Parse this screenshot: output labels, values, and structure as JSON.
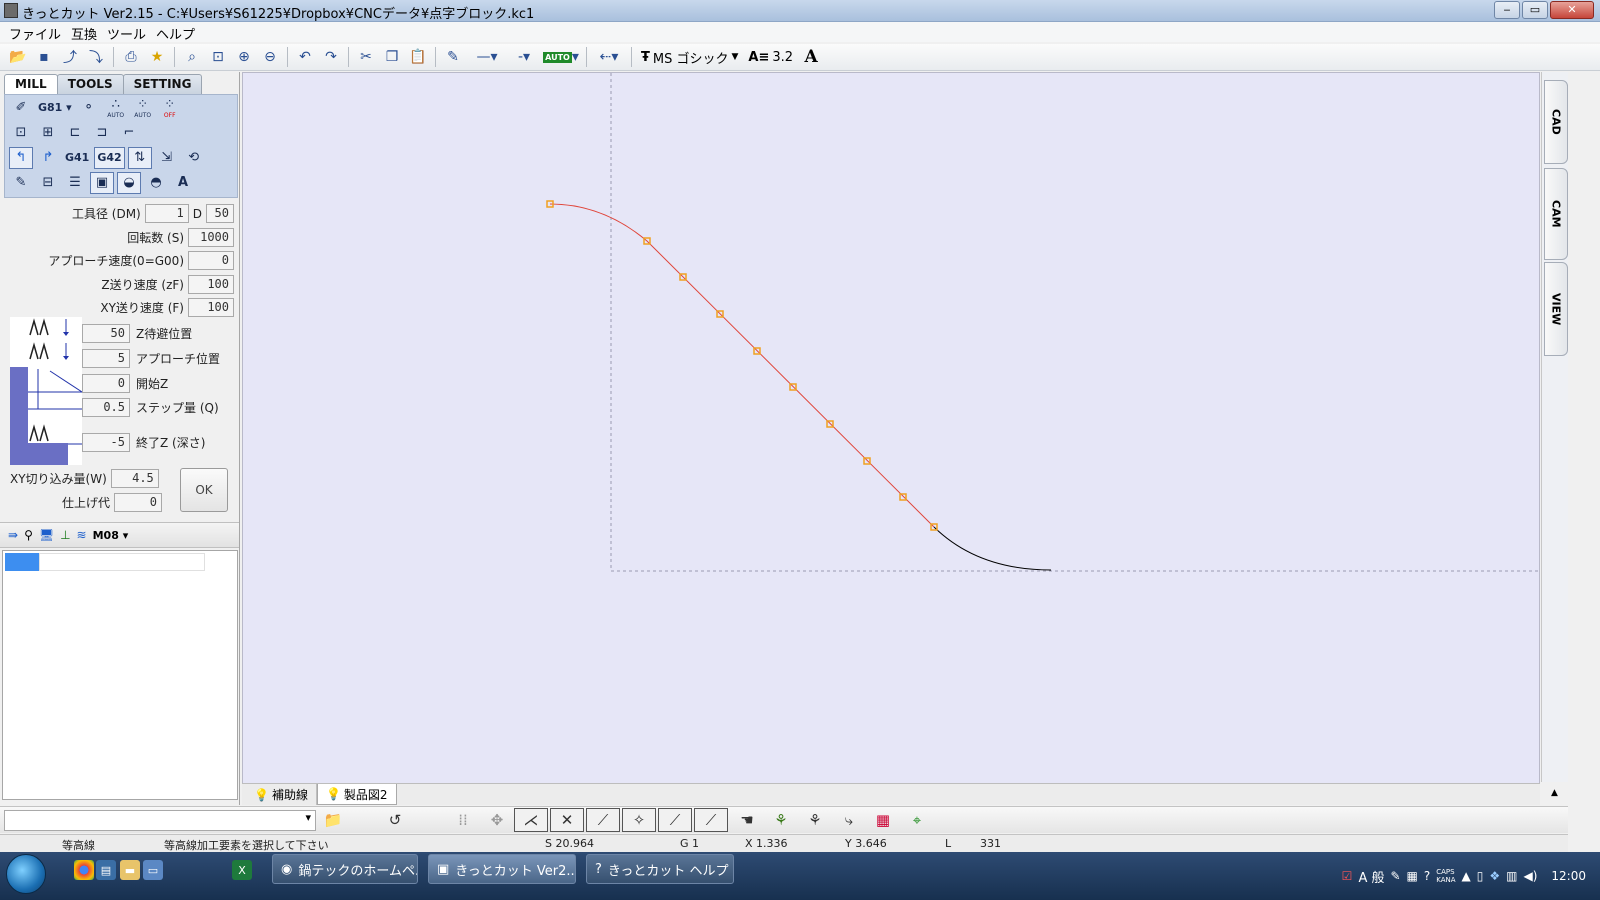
{
  "titlebar": {
    "title": "きっとカット Ver2.15 - C:¥Users¥S61225¥Dropbox¥CNCデータ¥点字ブロック.kc1",
    "minimize": "‒",
    "maximize": "▭",
    "close": "✕"
  },
  "menu": [
    "ファイル",
    "互換",
    "ツール",
    "ヘルプ"
  ],
  "toolbar": {
    "auto_label": "AUTO",
    "font_name": "MS ゴシック",
    "font_size": "3.2",
    "font_icon": "A"
  },
  "panel": {
    "tabs": [
      "MILL",
      "TOOLS",
      "SETTING"
    ],
    "active_tab": "MILL",
    "icons_row1": {
      "drill_label": "G81",
      "auto1": "AUTO",
      "auto2": "AUTO",
      "off": "OFF"
    },
    "icons_row3": {
      "g41": "G41",
      "g42": "G42"
    },
    "params": {
      "tool_dia_label": "工具径 (DM)",
      "tool_dia": "1",
      "d_label": "D",
      "d_value": "50",
      "spindle_label": "回転数 (S)",
      "spindle": "1000",
      "approach_speed_label": "アプローチ速度(0=G00)",
      "approach_speed": "0",
      "z_feed_label": "Z送り速度 (zF)",
      "z_feed": "100",
      "xy_feed_label": "XY送り速度 (F)",
      "xy_feed": "100"
    },
    "depth": {
      "z_wait": "50",
      "z_wait_label": "Z待避位置",
      "approach_pos": "5",
      "approach_pos_label": "アプローチ位置",
      "start_z": "0",
      "start_z_label": "開始Z",
      "step": "0.5",
      "step_label": "ステップ量 (Q)",
      "end_z": "-5",
      "end_z_label": "終了Z (深さ)"
    },
    "xy_cut_label": "XY切り込み量(W)",
    "xy_cut": "4.5",
    "finish_label": "仕上げ代",
    "finish": "0",
    "ok_label": "OK",
    "m08_label": "M08"
  },
  "right_tabs": [
    "CAD",
    "CAM",
    "VIEW"
  ],
  "canvas_tabs": [
    {
      "label": "補助線",
      "active": false
    },
    {
      "label": "製品図2",
      "active": true
    }
  ],
  "status": {
    "mode": "等高線",
    "message": "等高線加工要素を選択して下さい",
    "s": "S 20.964",
    "g": "G 1",
    "x": "X 1.336",
    "y": "Y 3.646",
    "l_label": "L",
    "l_value": "331"
  },
  "taskbar": {
    "buttons": [
      {
        "label": "鍋テックのホームペ...",
        "active": false
      },
      {
        "label": "きっとカット Ver2....",
        "active": true
      },
      {
        "label": "きっとカット ヘルプ",
        "active": false
      }
    ],
    "ime": "A 般",
    "caps": "CAPS",
    "kana": "KANA",
    "clock": "12:00"
  },
  "colors": {
    "canvas_bg": "#e6e6f7",
    "path_selected": "#e0453a",
    "node": "#f0a020",
    "path_normal": "#000000",
    "panel_icon_bg": "#c9d6ea"
  }
}
